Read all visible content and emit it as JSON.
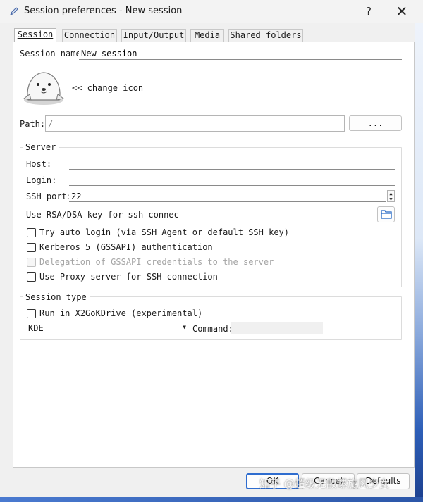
{
  "window": {
    "title": "Session preferences - New session",
    "help": "?",
    "close": "✕"
  },
  "tabs": [
    {
      "label": "Session",
      "active": true
    },
    {
      "label": "Connection"
    },
    {
      "label": "Input/Output"
    },
    {
      "label": "Media"
    },
    {
      "label": "Shared folders"
    }
  ],
  "session": {
    "name_label": "Session name:",
    "name_value": "New session",
    "change_icon": "<< change icon",
    "path_label": "Path:",
    "path_value": "/",
    "browse_label": "..."
  },
  "server": {
    "title": "Server",
    "host_label": "Host:",
    "host_value": "",
    "login_label": "Login:",
    "login_value": "",
    "port_label": "SSH port:",
    "port_value": "22",
    "key_label": "Use RSA/DSA key for ssh connection:",
    "key_value": "",
    "options": [
      {
        "label": "Try auto login (via SSH Agent or default SSH key)",
        "checked": false,
        "disabled": false
      },
      {
        "label": "Kerberos 5 (GSSAPI) authentication",
        "checked": false,
        "disabled": false
      },
      {
        "label": "Delegation of GSSAPI credentials to the server",
        "checked": false,
        "disabled": true
      },
      {
        "label": "Use Proxy server for SSH connection",
        "checked": false,
        "disabled": false
      }
    ]
  },
  "session_type": {
    "title": "Session type",
    "run_label": "Run in X2GoKDrive (experimental)",
    "type_value": "KDE",
    "command_label": "Command:",
    "command_value": ""
  },
  "buttons": {
    "ok": "OK",
    "cancel": "Cancel",
    "defaults": "Defaults"
  },
  "watermark": "知乎 @超级无敌螺旋风少女"
}
